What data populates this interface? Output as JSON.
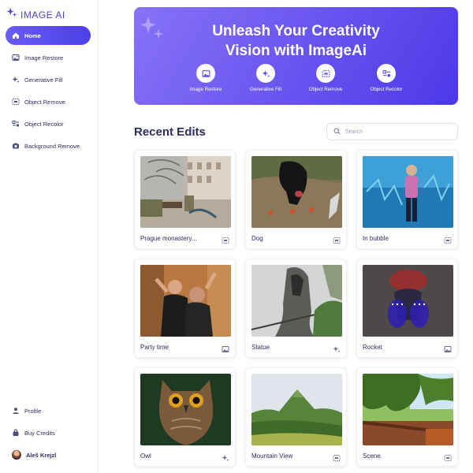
{
  "app": {
    "name": "IMAGE AI"
  },
  "sidebar": {
    "items": [
      {
        "label": "Home",
        "icon": "home-icon",
        "active": true
      },
      {
        "label": "Image Restore",
        "icon": "image-icon"
      },
      {
        "label": "Generative Fill",
        "icon": "sparkle-icon"
      },
      {
        "label": "Object Remove",
        "icon": "object-remove-icon"
      },
      {
        "label": "Object Recolor",
        "icon": "recolor-icon"
      },
      {
        "label": "Background Remove",
        "icon": "camera-icon"
      }
    ],
    "bottom": [
      {
        "label": "Profile",
        "icon": "user-icon"
      },
      {
        "label": "Buy Credits",
        "icon": "bag-icon"
      },
      {
        "label": "Aleš Krejzl",
        "icon": "avatar"
      }
    ]
  },
  "hero": {
    "title_line1": "Unleash Your Creativity",
    "title_line2": "Vision with ImageAi",
    "tools": [
      {
        "label": "Image Restore",
        "icon": "image-icon"
      },
      {
        "label": "Generative Fill",
        "icon": "sparkle-icon"
      },
      {
        "label": "Object Remove",
        "icon": "object-remove-icon"
      },
      {
        "label": "Object Recolor",
        "icon": "recolor-icon"
      }
    ]
  },
  "recent": {
    "title": "Recent Edits",
    "search_placeholder": "Search",
    "items": [
      {
        "label": "Prague monastery...",
        "tool_icon": "object-remove-icon"
      },
      {
        "label": "Dog",
        "tool_icon": "object-remove-icon"
      },
      {
        "label": "In bubble",
        "tool_icon": "object-remove-icon"
      },
      {
        "label": "Party time",
        "tool_icon": "image-icon"
      },
      {
        "label": "Statue",
        "tool_icon": "sparkle-icon"
      },
      {
        "label": "Rocket",
        "tool_icon": "image-icon"
      },
      {
        "label": "Owl",
        "tool_icon": "sparkle-icon"
      },
      {
        "label": "Mountain View",
        "tool_icon": "object-remove-icon"
      },
      {
        "label": "Scene",
        "tool_icon": "object-remove-icon"
      }
    ]
  },
  "colors": {
    "accent": "#5b4cf0",
    "text": "#2b2d5c",
    "muted": "#9a9cb3"
  }
}
